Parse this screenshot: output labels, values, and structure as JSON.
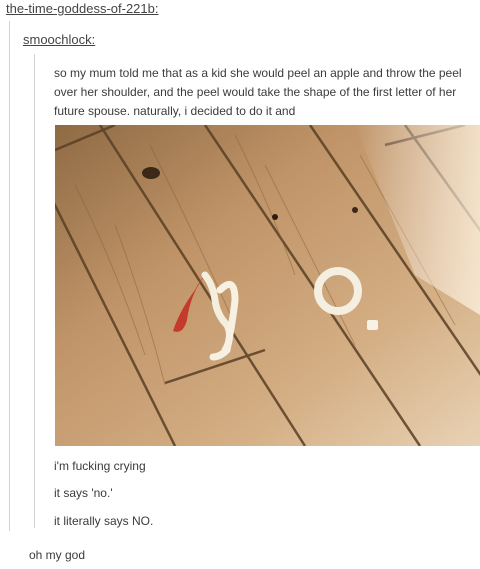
{
  "post": {
    "reblogger": "the-time-goddess-of-221b:",
    "nested_user": "smoochlock:",
    "original_text": "so my mum told me that as a kid she would peel an apple and throw the peel over her shoulder, and the peel would take the shape of the first letter of her future spouse. naturally, i decided to do it and",
    "photo_label": "apple peel on wooden floor",
    "nested_replies": [
      "i'm fucking crying",
      "it says 'no.'",
      "it literally says NO."
    ],
    "outer_reply": "oh my god"
  },
  "colors": {
    "link": "#444444",
    "quote_border": "#cfd3d6",
    "text": "#3b3b3b",
    "wood": "#c79c6e"
  }
}
